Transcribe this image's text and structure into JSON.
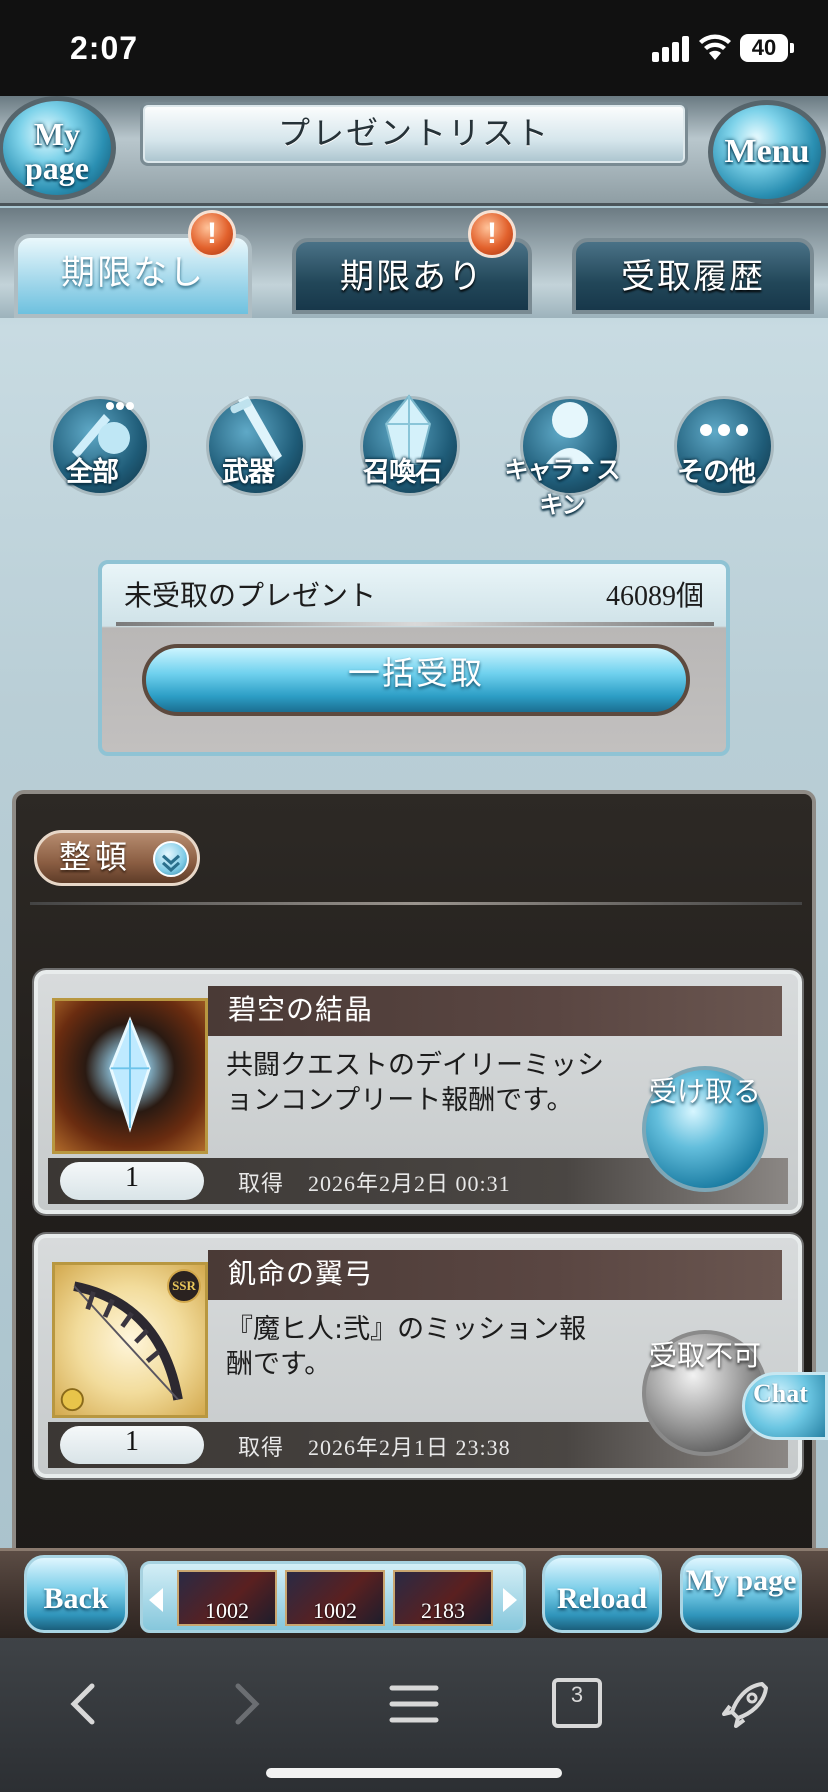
{
  "status": {
    "time": "2:07",
    "battery": "40"
  },
  "header": {
    "title": "プレゼントリスト",
    "mypage_label": "My page",
    "menu_label": "Menu"
  },
  "tabs": [
    {
      "label": "期限なし",
      "active": true,
      "alert": "!"
    },
    {
      "label": "期限あり",
      "active": false,
      "alert": "!"
    },
    {
      "label": "受取履歴",
      "active": false
    }
  ],
  "categories": [
    {
      "label": "全部",
      "icon": "all-items-icon"
    },
    {
      "label": "武器",
      "icon": "weapon-icon"
    },
    {
      "label": "召喚石",
      "icon": "summon-stone-icon"
    },
    {
      "label": "キャラ・スキン",
      "icon": "character-skin-icon"
    },
    {
      "label": "その他",
      "icon": "other-icon"
    }
  ],
  "summary": {
    "label": "未受取のプレゼント",
    "count": "46089個",
    "bulk_button": "一括受取"
  },
  "sort_button": "整頓",
  "presents": [
    {
      "name": "碧空の結晶",
      "description": "共闘クエストのデイリーミッションコンプリート報酬です。",
      "quantity": "1",
      "date_label": "取得",
      "date": "2026年2月2日 00:31",
      "action": "受け取る",
      "enabled": true
    },
    {
      "name": "飢命の翼弓",
      "description": "『魔ヒ人:弐』のミッション報酬です。",
      "quantity": "1",
      "date_label": "取得",
      "date": "2026年2月1日 23:38",
      "action": "受取不可",
      "enabled": false,
      "rarity": "SSR"
    }
  ],
  "chat_button": "Chat",
  "bottom_bar": {
    "back": "Back",
    "reload": "Reload",
    "mypage": "My page",
    "items": [
      "1002",
      "1002",
      "2183"
    ]
  },
  "browser": {
    "tab_count": "3"
  }
}
